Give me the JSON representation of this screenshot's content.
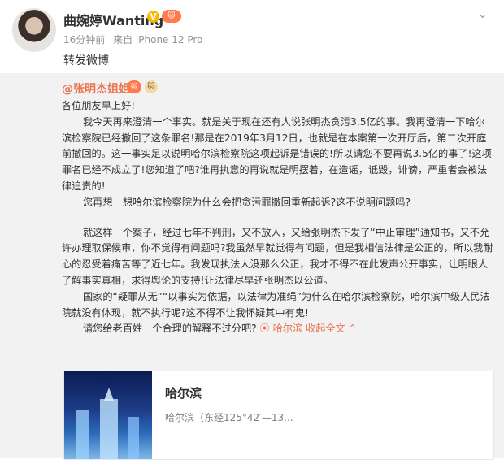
{
  "post": {
    "username": "曲婉婷Wanting",
    "verified_symbol": "V",
    "badge_symbol": "🐱",
    "time": "16分钟前",
    "source": "来自 iPhone 12 Pro",
    "text": "转发微博",
    "menu_icon": "chevron-down"
  },
  "quoted": {
    "author": "@张明杰姐姐",
    "badge1_symbol": "😻",
    "badge2_symbol": "🐱",
    "greeting": "各位朋友早上好!",
    "p1": "我今天再来澄清一个事实。就是关于现在还有人说张明杰贪污3.5亿的事。我再澄清一下哈尔滨检察院已经撤回了这条罪名!那是在2019年3月12日，也就是在本案第一次开厅后，第二次开庭前撤回的。这一事实足以说明哈尔滨检察院这项起诉是错误的!所以请您不要再说3.5亿的事了!这项罪名已经不成立了!您知道了吧?谁再执意的再说就是明摆着，在造谣，诋毁，诽谤，严重者会被法律追责的!",
    "p2": "您再想一想哈尔滨检察院为什么会把贪污罪撤回重新起诉?这不说明问题吗?",
    "p3": "就这样一个案子，经过七年不判刑，又不放人，又给张明杰下发了“中止审理”通知书，又不允许办理取保候审，你不觉得有问题吗?我虽然早就觉得有问题，但是我相信法律是公正的，所以我耐心的忍受着痛苦等了近七年。我发现执法人没那么公正，我才不得不在此发声公开事实，让明眼人了解事实真相，求得舆论的支持!让法律尽早还张明杰以公道。",
    "p4": "国家的“疑罪从无”“以事实为依据，以法律为准绳”为什么在哈尔滨检察院，哈尔滨中级人民法院就没有体现，就不执行呢?这不得不让我怀疑其中有鬼!",
    "p5": "请您给老百姓一个合理的解释不过分吧?",
    "location_link": "⦿ 哈尔滨",
    "expand_link": "收起全文 ⌃"
  },
  "card": {
    "title": "哈尔滨",
    "subtitle": "哈尔滨（东经125°42′—13..."
  }
}
